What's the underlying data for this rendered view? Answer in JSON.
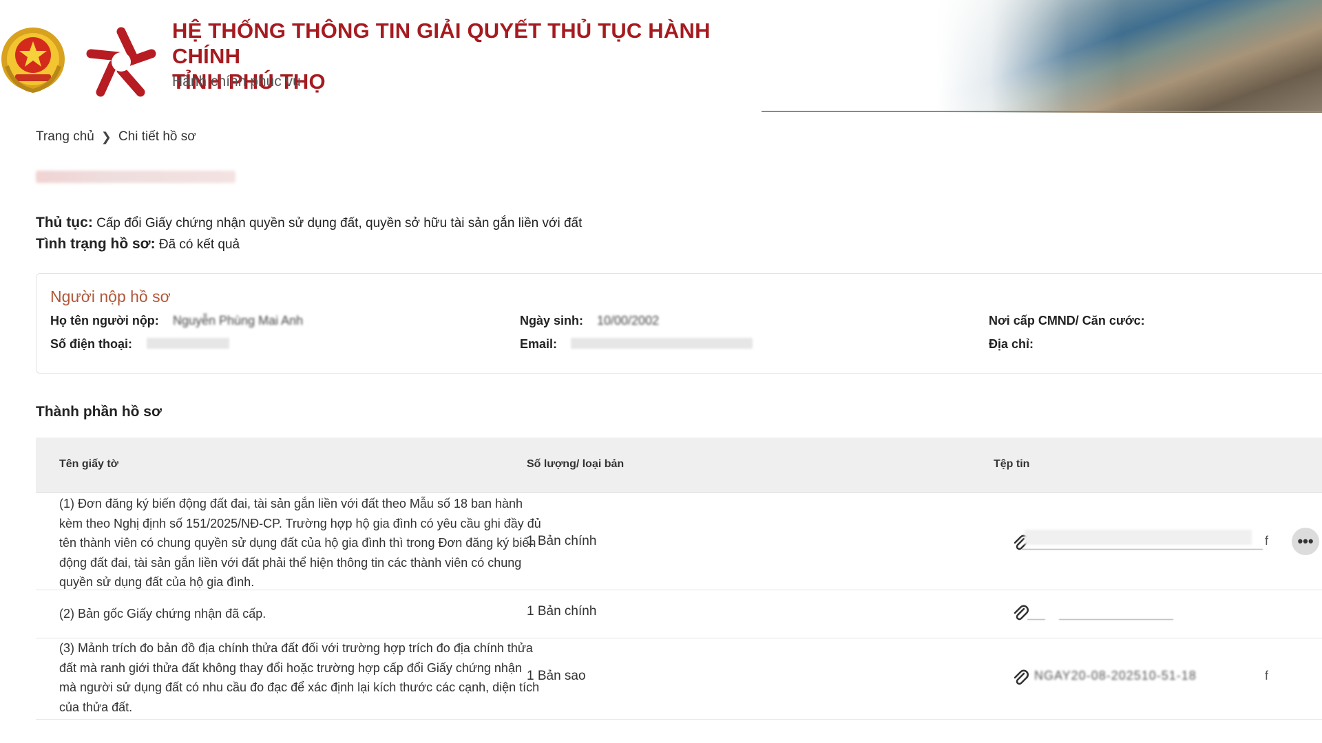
{
  "header": {
    "title_line1": "HỆ THỐNG THÔNG TIN GIẢI QUYẾT THỦ TỤC HÀNH CHÍNH",
    "title_line2": "TỈNH PHÚ THỌ",
    "subtitle": "Hành chính phục vụ",
    "emblem_icon": "national-emblem-icon",
    "logo_icon": "red-star-logo-icon",
    "brand_color": "#a51b20"
  },
  "breadcrumb": {
    "home": "Trang chủ",
    "separator_icon": "chevron-right-icon",
    "current": "Chi tiết hồ sơ"
  },
  "summary": {
    "procedure_label": "Thủ tục:",
    "procedure_value": " Cấp đổi Giấy chứng nhận quyền sử dụng đất, quyền sở hữu tài sản gắn liền với đất",
    "status_label": "Tình trạng hồ sơ:",
    "status_value": " Đã có kết quả"
  },
  "applicant": {
    "title": "Người nộp hồ sơ",
    "name_label": "Họ tên người nộp:",
    "name_value": "Nguyễn Phùng Mai Anh",
    "phone_label": "Số điện thoại:",
    "dob_label": "Ngày sinh:",
    "dob_value": "10/00/2002",
    "email_label": "Email:",
    "issuer_label": "Nơi cấp CMND/ Căn cước:",
    "address_label": "Địa chỉ:"
  },
  "documents": {
    "title": "Thành phần hồ sơ",
    "columns": [
      "Tên giấy tờ",
      "Số lượng/ loại bản",
      "Tệp tin"
    ],
    "rows": [
      {
        "name": "(1) Đơn đăng ký biến động đất đai, tài sản gắn liền với đất theo Mẫu số 18 ban hành kèm theo Nghị định số 151/2025/NĐ-CP. Trường hợp hộ gia đình có yêu cầu ghi đầy đủ tên thành viên có chung quyền sử dụng đất của hộ gia đình thì trong Đơn đăng ký biến động đất đai, tài sản gắn liền với đất phải thể hiện thông tin các thành viên có chung quyền sử dụng đất của hộ gia đình.",
        "quantity": "1 Bản chính",
        "file": "",
        "file_suffix": "f"
      },
      {
        "name": "(2) Bản gốc Giấy chứng nhận đã cấp.",
        "quantity": "1 Bản chính",
        "file": "",
        "file_suffix": ""
      },
      {
        "name": "(3) Mảnh trích đo bản đồ địa chính thửa đất đối với trường hợp trích đo địa chính thửa đất mà ranh giới thửa đất không thay đổi hoặc trường hợp cấp đổi Giấy chứng nhận mà người sử dụng đất có nhu cầu đo đạc để xác định lại kích thước các cạnh, diện tích của thửa đất.",
        "quantity": "1 Bản sao",
        "file": "NGAY20-08-202510-51-18",
        "file_suffix": "f"
      }
    ],
    "attachment_icon": "paperclip-icon",
    "more_icon": "more-horizontal-icon"
  }
}
